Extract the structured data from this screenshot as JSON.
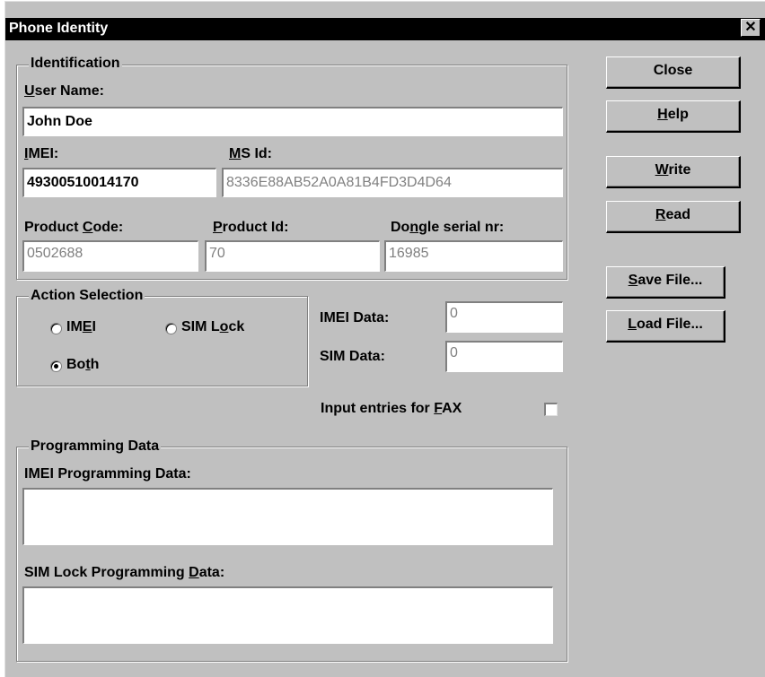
{
  "window": {
    "title": "Phone Identity",
    "close_glyph": "✕"
  },
  "identification": {
    "legend": "Identification",
    "user_name_label": "User Name:",
    "user_name_value": "John Doe",
    "imei_label": "IMEI:",
    "imei_value": "49300510014170",
    "ms_id_label": "MS Id:",
    "ms_id_value": "8336E88AB52A0A81B4FD3D4D64",
    "product_code_label": "Product Code:",
    "product_code_value": "0502688",
    "product_id_label": "Product Id:",
    "product_id_value": "70",
    "dongle_label": "Dongle serial nr:",
    "dongle_value": "16985"
  },
  "action_selection": {
    "legend": "Action Selection",
    "options": [
      {
        "label": "IMEI",
        "selected": false
      },
      {
        "label": "SIM Lock",
        "selected": false
      },
      {
        "label": "Both",
        "selected": true
      }
    ]
  },
  "data_fields": {
    "imei_data_label": "IMEI Data:",
    "imei_data_value": "0",
    "sim_data_label": "SIM Data:",
    "sim_data_value": "0"
  },
  "fax": {
    "label": "Input entries for FAX",
    "checked": false
  },
  "programming": {
    "legend": "Programming Data",
    "imei_label": "IMEI Programming Data:",
    "imei_value": "",
    "sim_label": "SIM Lock Programming Data:",
    "sim_value": ""
  },
  "buttons": {
    "close": "Close",
    "help": "Help",
    "write": "Write",
    "read": "Read",
    "save_file": "Save File...",
    "load_file": "Load File..."
  },
  "colors": {
    "title_bar": "#000000",
    "dialog_face": "#c0c0c0",
    "readonly_text": "#808080"
  }
}
